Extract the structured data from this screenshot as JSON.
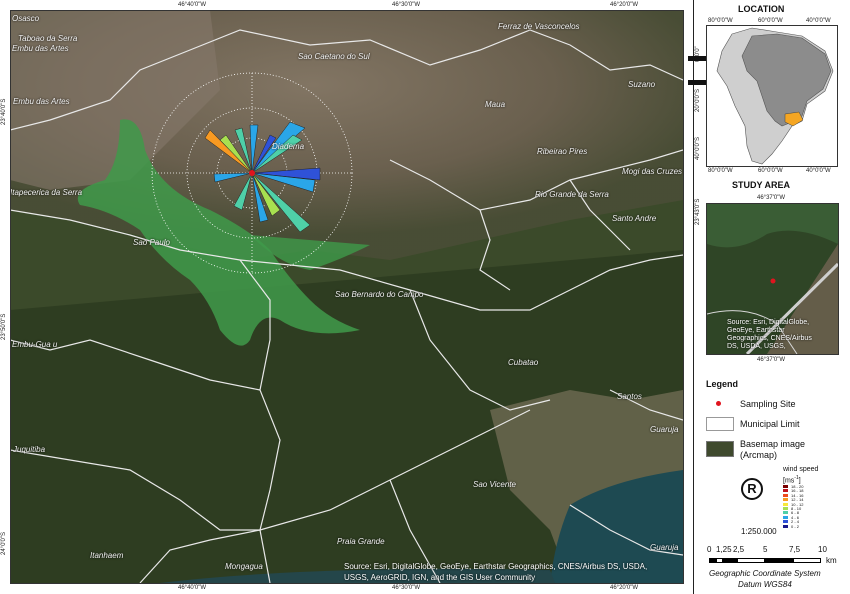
{
  "map": {
    "top_ticks": [
      "46°40'0\"W",
      "46°30'0\"W",
      "46°20'0\"W"
    ],
    "bottom_ticks": [
      "46°40'0\"W",
      "46°30'0\"W",
      "46°20'0\"W"
    ],
    "left_ticks": [
      "23°40'0\"S",
      "23°50'0\"S",
      "24°0'0\"S"
    ],
    "cities": [
      "Osasco",
      "Taboao da Serra",
      "Embu das Artes",
      "Embu das Artes",
      "Sao Caetano do Sul",
      "Ferraz de Vasconcelos",
      "Suzano",
      "Maua",
      "Ribeirao Pires",
      "Rio Grande da Serra",
      "Mogi das Cruzes",
      "Santo Andre",
      "Itapecerica da Serra",
      "Sao Paulo",
      "Diadema",
      "Sao Bernardo do Campo",
      "Embu-Gua u",
      "Cubatao",
      "Santos",
      "Juquitiba",
      "Guaruja",
      "Sao Vicente",
      "Praia Grande",
      "Itanhaem",
      "Mongagua",
      "Guaruja"
    ],
    "source_line1": "Source: Esri, DigitalGlobe, GeoEye, Earthstar Geographics, CNES/Airbus DS, USDA,",
    "source_line2": "USGS, AeroGRID, IGN, and the GIS User Community"
  },
  "location": {
    "title": "LOCATION",
    "top_ticks": [
      "80°0'0\"W",
      "60°0'0\"W",
      "40°0'0\"W"
    ],
    "bottom_ticks": [
      "80°0'0\"W",
      "60°0'0\"W",
      "40°0'0\"W"
    ],
    "left_ticks": [
      "0°0'0\"",
      "20°0'0\"S",
      "40°0'0\"S"
    ],
    "highlight_color": "#f5a623"
  },
  "study_area": {
    "title": "STUDY AREA",
    "top_tick": "46°37'0\"W",
    "bottom_tick": "46°37'0\"W",
    "left_tick": "23°43'0\"S",
    "source": [
      "Source: Esri, DigitalGlobe,",
      "GeoEye, Earthstar",
      "Geographics, CNES/Airbus",
      "DS, USDA, USGS,"
    ]
  },
  "legend": {
    "title": "Legend",
    "items": [
      "Sampling Site",
      "Municipal Limit",
      "Basemap image",
      "(Arcmap)"
    ],
    "wind_title": "wind speed",
    "wind_unit": "[ms",
    "wind_exp": "-1",
    "wind_classes": [
      "18 - 20",
      "16 - 18",
      "14 - 16",
      "12 - 14",
      "10 - 12",
      "8 - 10",
      "6 - 8",
      "4 - 6",
      "2 - 4",
      "0 - 2"
    ],
    "wind_colors": [
      "#7a0000",
      "#c0141e",
      "#ee4a1c",
      "#f89a22",
      "#f8e83a",
      "#a8e050",
      "#4fd0a8",
      "#2aa6e8",
      "#2f52d8",
      "#1a1a8c"
    ],
    "site_color": "#e0141e"
  },
  "scale": {
    "ratio": "1:250.000",
    "labels": [
      "0",
      "1,25",
      "2,5",
      "5",
      "7,5",
      "10"
    ],
    "unit": "km",
    "crs1": "Geographic Coordinate System",
    "crs2": "Datum WGS84"
  }
}
